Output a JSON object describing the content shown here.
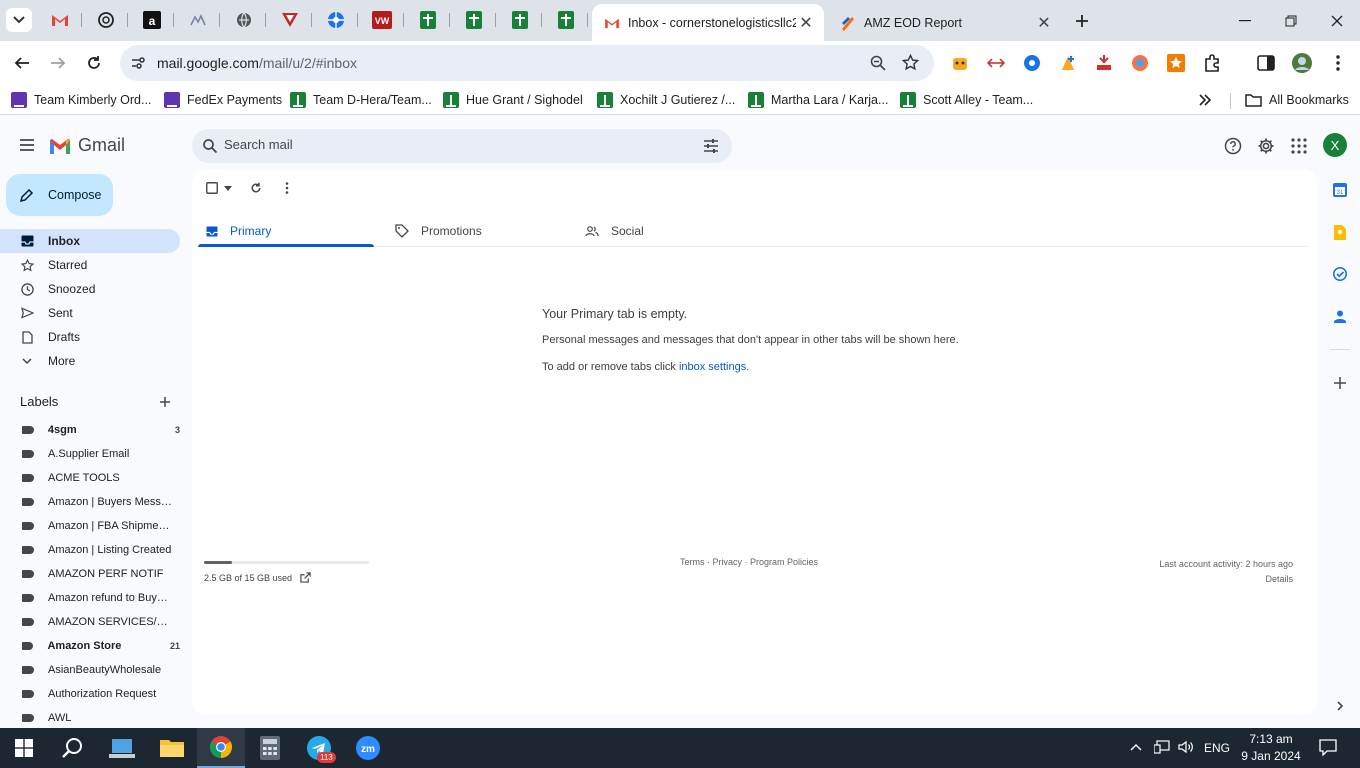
{
  "browser": {
    "tabs": [
      {
        "title": "Inbox - cornerstonelogisticsllc2",
        "active": true
      },
      {
        "title": "AMZ EOD Report",
        "active": false
      }
    ],
    "url_host": "mail.google.com",
    "url_path": "/mail/u/2/#inbox",
    "bookmarks": [
      "Team Kimberly Ord...",
      "FedEx Payments",
      "Team D-Hera/Team...",
      "Hue Grant / Sighodel",
      "Xochilt J Gutierez /...",
      "Martha Lara / Karja...",
      "Scott Alley - Team...",
      "All Bookmarks"
    ]
  },
  "gmail": {
    "logo_text": "Gmail",
    "search_placeholder": "Search mail",
    "avatar_letter": "X",
    "compose_label": "Compose",
    "nav": [
      {
        "label": "Inbox",
        "icon": "inbox-icon"
      },
      {
        "label": "Starred",
        "icon": "star-icon"
      },
      {
        "label": "Snoozed",
        "icon": "clock-icon"
      },
      {
        "label": "Sent",
        "icon": "send-icon"
      },
      {
        "label": "Drafts",
        "icon": "draft-icon"
      },
      {
        "label": "More",
        "icon": "chevron-down-icon"
      }
    ],
    "labels_title": "Labels",
    "labels": [
      {
        "name": "4sgm",
        "count": "3",
        "bold": true
      },
      {
        "name": "A.Supplier Email",
        "count": "",
        "bold": false
      },
      {
        "name": "ACME TOOLS",
        "count": "",
        "bold": false
      },
      {
        "name": "Amazon | Buyers Messa...",
        "count": "",
        "bold": false
      },
      {
        "name": "Amazon | FBA Shipments",
        "count": "",
        "bold": false
      },
      {
        "name": "Amazon | Listing Created",
        "count": "",
        "bold": false
      },
      {
        "name": "AMAZON PERF NOTIF",
        "count": "",
        "bold": false
      },
      {
        "name": "Amazon refund to Buyers",
        "count": "",
        "bold": false
      },
      {
        "name": "AMAZON SERVICES/PAY...",
        "count": "",
        "bold": false
      },
      {
        "name": "Amazon Store",
        "count": "21",
        "bold": true
      },
      {
        "name": "AsianBeautyWholesale",
        "count": "",
        "bold": false
      },
      {
        "name": "Authorization Request",
        "count": "",
        "bold": false
      },
      {
        "name": "AWL",
        "count": "",
        "bold": false
      }
    ],
    "categories": [
      {
        "label": "Primary",
        "icon": "inbox-icon"
      },
      {
        "label": "Promotions",
        "icon": "tag-icon"
      },
      {
        "label": "Social",
        "icon": "people-icon"
      }
    ],
    "empty": {
      "title": "Your Primary tab is empty.",
      "description": "Personal messages and messages that don't appear in other tabs will be shown here.",
      "settings_prefix": "To add or remove tabs click ",
      "settings_link": "inbox settings."
    },
    "storage": {
      "text": "2.5 GB of 15 GB used",
      "fraction": 0.167
    },
    "footer_links": "Terms · Privacy · Program Policies",
    "activity_line": "Last account activity: 2 hours ago",
    "details_link": "Details"
  },
  "taskbar": {
    "language": "ENG",
    "time": "7:13 am",
    "date": "9 Jan 2024",
    "telegram_badge": "113"
  },
  "colors": {
    "accent_blue": "#0b57d0",
    "compose_bg": "#c2e7ff",
    "active_nav_bg": "#d3e3fd",
    "tabstrip": "#dee3ea"
  }
}
